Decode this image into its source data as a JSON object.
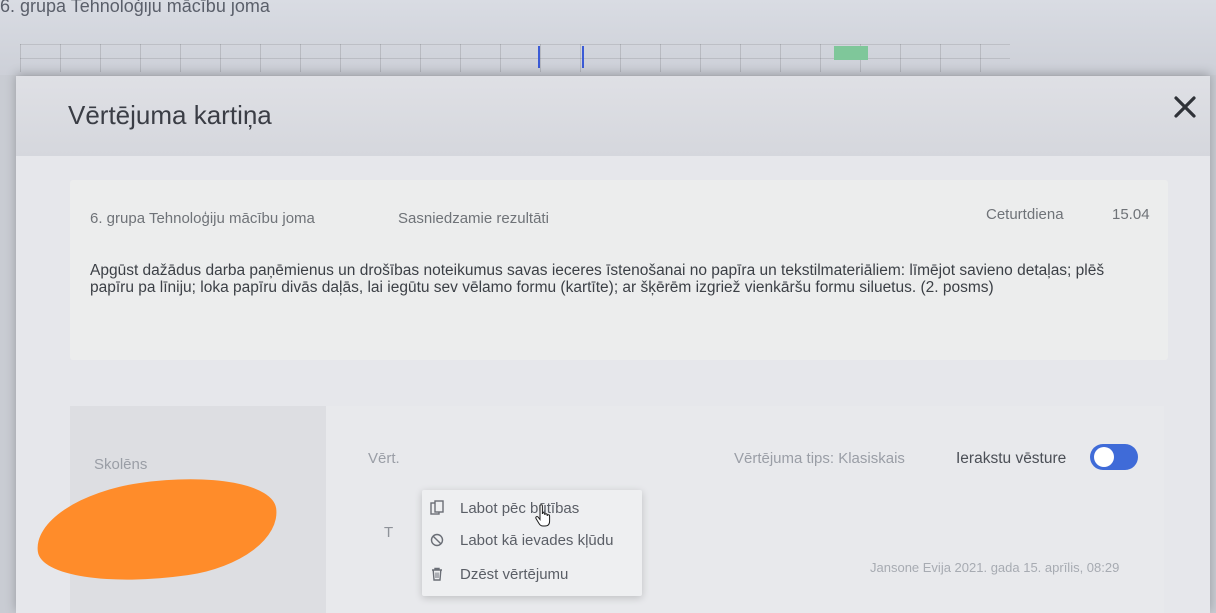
{
  "background": {
    "page_title": "6. grupa Tehnoloģiju mācību joma"
  },
  "modal": {
    "title": "Vērtējuma kartiņa",
    "close_icon": "close-icon",
    "info": {
      "group": "6. grupa Tehnoloģiju mācību joma",
      "results_label": "Sasniedzamie rezultāti",
      "day": "Ceturtdiena",
      "date": "15.04",
      "description": "Apgūst dažādus darba paņēmienus un drošības noteikumus savas ieceres īstenošanai no papīra un tekstilmateriāliem: līmējot savieno detaļas; plēš papīru pa līniju; loka papīru divās daļās, lai iegūtu sev vēlamo formu (kartīte); ar šķērēm izgriež vienkāršu formu siluetus. (2. posms)"
    },
    "table": {
      "student_header": "Skolēns",
      "grade_header": "Vērt.",
      "grade_type": "Vērtējuma tips: Klasiskais",
      "history_label": "Ierakstu vēsture",
      "history_enabled": true,
      "grade_value": "T",
      "audit_text": "Jansone Evija 2021. gada 15. aprīlis, 08:29"
    },
    "context_menu": [
      {
        "label": "Labot pēc būtības",
        "icon": "edit-copy-icon"
      },
      {
        "label": "Labot kā ievades kļūdu",
        "icon": "block-icon"
      },
      {
        "label": "Dzēst vērtējumu",
        "icon": "trash-icon"
      }
    ]
  },
  "colors": {
    "accent": "#3f6bd8",
    "redaction": "#ff8c2a"
  }
}
